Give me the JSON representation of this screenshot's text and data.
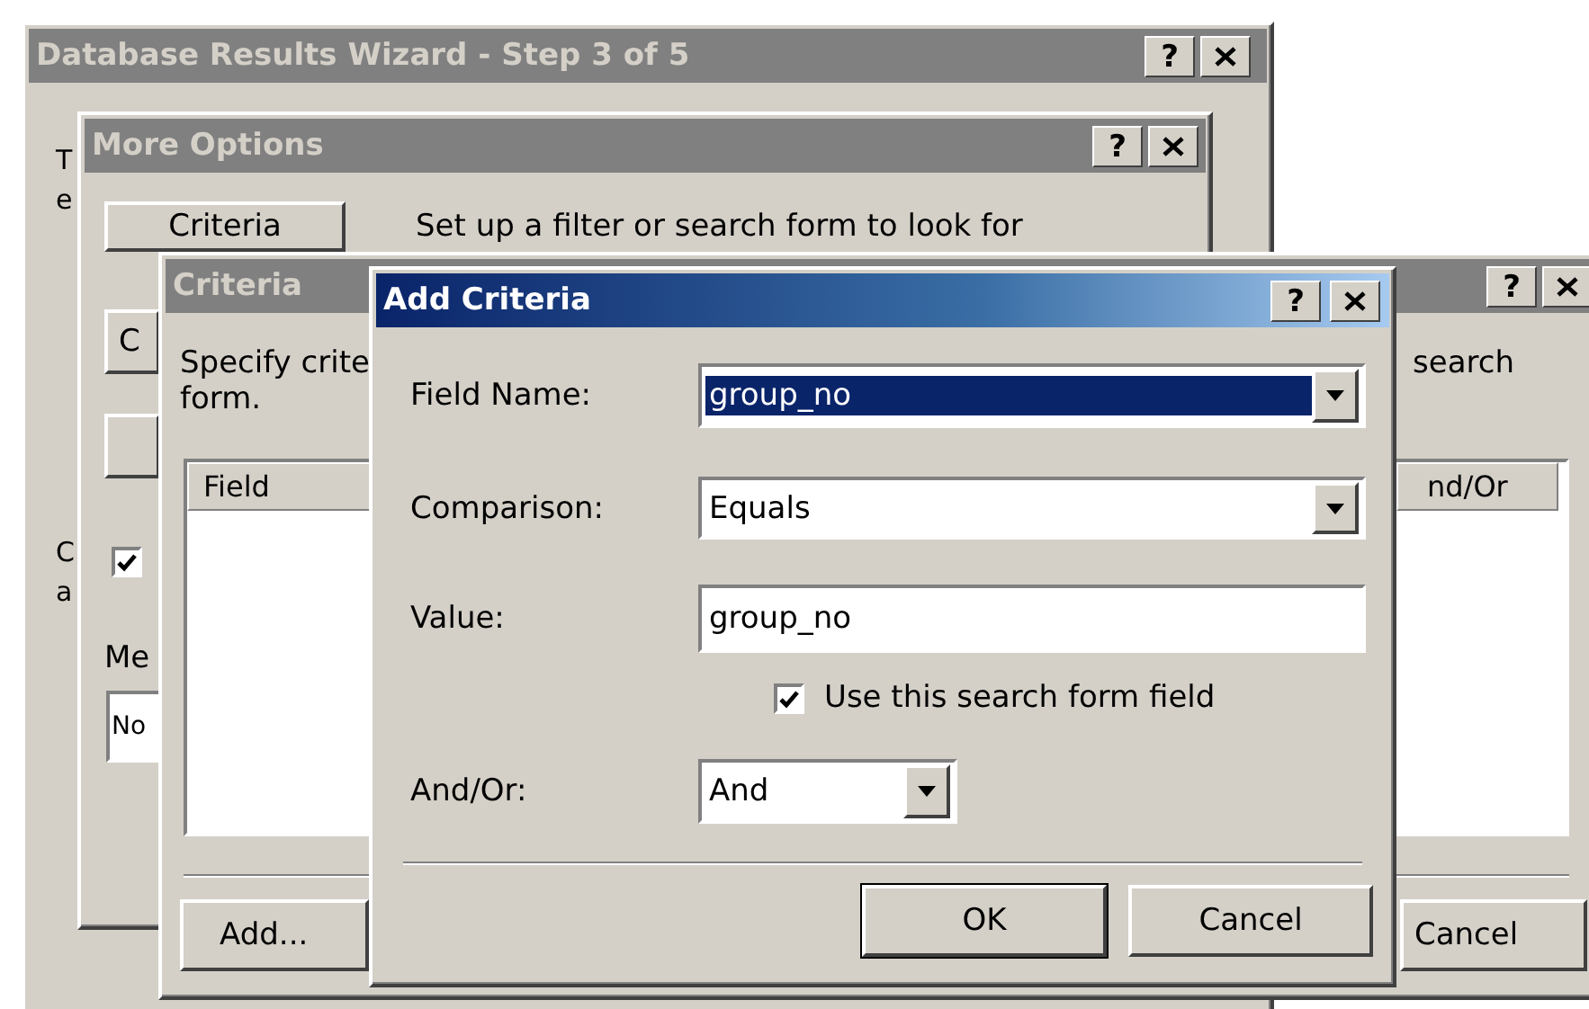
{
  "wizard": {
    "title": "Database Results Wizard - Step 3 of 5",
    "active": false,
    "help": "?",
    "fragments": [
      "T",
      "e",
      "C",
      "a"
    ]
  },
  "more_options": {
    "title": "More Options",
    "active": false,
    "help": "?",
    "tab_buttons": [
      "Criteria",
      "C"
    ],
    "description": "Set up a filter or search form to look for",
    "checkbox": {
      "checked": true
    },
    "message_label": "Me",
    "message_value": "No"
  },
  "criteria": {
    "title": "Criteria",
    "active": false,
    "help": "?",
    "description_left": [
      "Specify crite",
      "form."
    ],
    "description_right": "search",
    "columns": [
      "Field",
      "nd/Or"
    ],
    "buttons": [
      "Add...",
      "Cancel"
    ]
  },
  "add_criteria": {
    "title": "Add Criteria",
    "active": true,
    "help": "?",
    "field_name": {
      "label": "Field Name:",
      "value": "group_no",
      "highlighted": true
    },
    "comparison": {
      "label": "Comparison:",
      "value": "Equals",
      "highlighted": false
    },
    "value": {
      "label": "Value:",
      "value": "group_no"
    },
    "use_field": {
      "label": "Use this search form field",
      "checked": true
    },
    "and_or": {
      "label": "And/Or:",
      "value": "And",
      "highlighted": false
    },
    "buttons": [
      {
        "label": "OK",
        "default": true
      },
      {
        "label": "Cancel",
        "default": false
      }
    ]
  }
}
